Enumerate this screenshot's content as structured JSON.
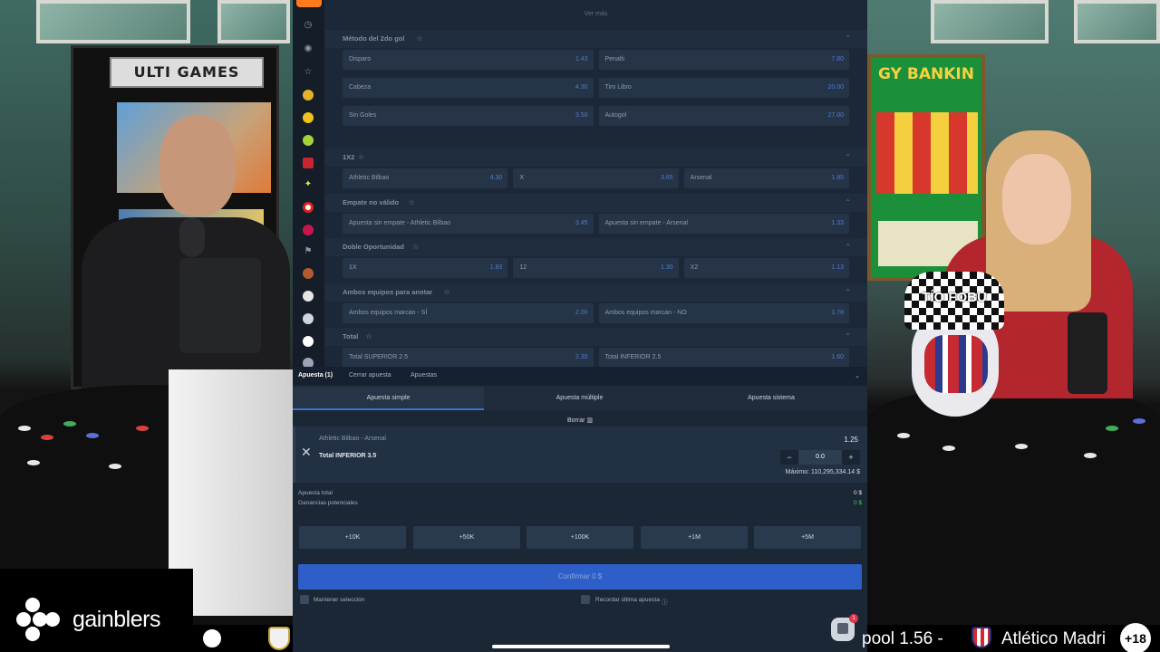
{
  "studio": {
    "arcade_marquee": "ULTI GAMES",
    "slot_title": "GY BANKIN",
    "mascot_title": "TÍO FOBU"
  },
  "markets": {
    "ver_mas": "Ver más",
    "sections": [
      {
        "title": "Método del 2do gol",
        "rows": [
          [
            {
              "label": "Disparo",
              "odd": "1.43"
            },
            {
              "label": "Penalti",
              "odd": "7.80"
            }
          ],
          [
            {
              "label": "Cabeza",
              "odd": "4.30"
            },
            {
              "label": "Tiro Libro",
              "odd": "20.00"
            }
          ],
          [
            {
              "label": "Sin Goles",
              "odd": "3.50"
            },
            {
              "label": "Autogol",
              "odd": "27.00"
            }
          ]
        ]
      },
      {
        "title": "1X2",
        "rows": [
          [
            {
              "label": "Athletic Bilbao",
              "odd": "4.30"
            },
            {
              "label": "X",
              "odd": "3.65"
            },
            {
              "label": "Arsenal",
              "odd": "1.85"
            }
          ]
        ]
      },
      {
        "title": "Empate no válido",
        "rows": [
          [
            {
              "label": "Apuesta sin empate - Athletic Bilbao",
              "odd": "3.45"
            },
            {
              "label": "Apuesta sin empate - Arsenal",
              "odd": "1.33"
            }
          ]
        ]
      },
      {
        "title": "Doble Oportunidad",
        "rows": [
          [
            {
              "label": "1X",
              "odd": "1.83"
            },
            {
              "label": "12",
              "odd": "1.30"
            },
            {
              "label": "X2",
              "odd": "1.13"
            }
          ]
        ]
      },
      {
        "title": "Ambos equipos para anotar",
        "rows": [
          [
            {
              "label": "Ambos equipos marcan - SÍ",
              "odd": "2.00"
            },
            {
              "label": "Ambos equipos marcan - NO",
              "odd": "1.78"
            }
          ]
        ]
      },
      {
        "title": "Total",
        "rows": [
          [
            {
              "label": "Total SUPERIOR  2.5",
              "odd": "2.30"
            },
            {
              "label": "Total INFERIOR  2.5",
              "odd": "1.60"
            }
          ]
        ]
      }
    ]
  },
  "slip": {
    "tabs": [
      "Apuesta (1)",
      "Cerrar apuesta",
      "Apuestas"
    ],
    "types": [
      "Apuesta simple",
      "Apuesta múltiple",
      "Apuesta sistema"
    ],
    "borrar": "Borrar",
    "bet": {
      "match": "Athletic Bilbao - Arsenal",
      "selection": "Total INFERIOR 3.5",
      "odds": "1.25",
      "minus": "−",
      "plus": "+",
      "amount": "0.0",
      "max": "Máximo: 110,295,334.14 $"
    },
    "total_label": "Apuesta total",
    "total_value": "0 $",
    "potential_label": "Ganancias potenciales",
    "potential_value": "0 $",
    "quick_amounts": [
      "+10K",
      "+50K",
      "+100K",
      "+1M",
      "+5M"
    ],
    "confirm": "Confirmar 0 $",
    "keep_selection": "Mantener selección",
    "remember_last": "Recordar última apuesta",
    "chat_badge": "1",
    "colors": {
      "accent": "#2e5ec8",
      "positive": "#3ecf5e"
    }
  },
  "overlay": {
    "brand": "gainblers",
    "ticker_right_text": "pool  1.56   -",
    "ticker_right_team": "Atlético Madri",
    "age": "+18"
  }
}
